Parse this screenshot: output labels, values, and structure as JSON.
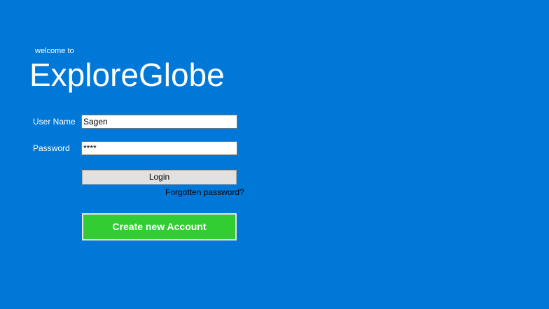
{
  "header": {
    "welcome_text": "welcome to",
    "app_title": "ExploreGlobe"
  },
  "form": {
    "username_label": "User Name",
    "username_value": "Sagen",
    "password_label": "Password",
    "password_value": "****",
    "login_label": "Login",
    "forgot_password_label": "Forgotten password?",
    "create_account_label": "Create new Account"
  },
  "colors": {
    "background": "#0078D7",
    "create_account_button": "#32CD32",
    "login_button": "#E1E1E1"
  }
}
